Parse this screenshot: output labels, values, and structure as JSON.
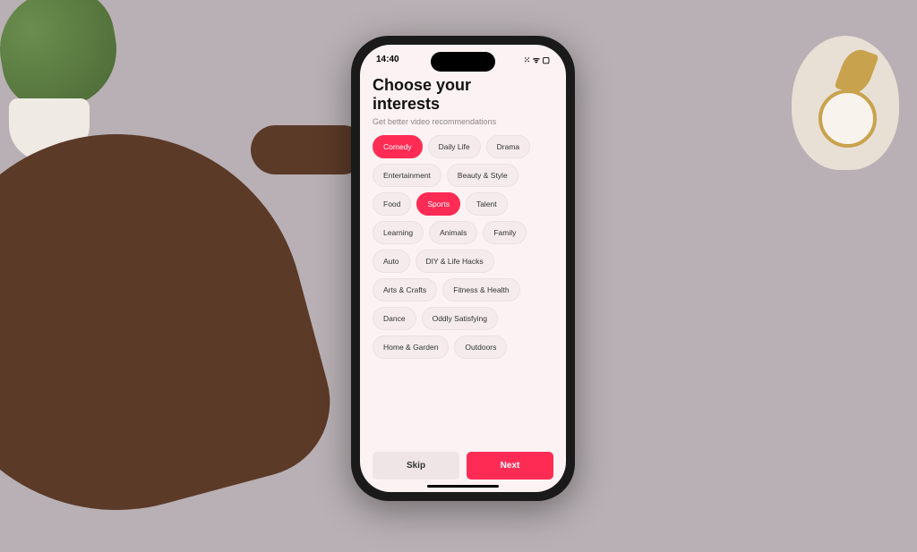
{
  "status": {
    "time": "14:40",
    "icons": "⁙ ᯤ ▢"
  },
  "header": {
    "title_line1": "Choose your",
    "title_line2": "interests",
    "subtitle": "Get better video recommendations"
  },
  "chips": [
    {
      "label": "Comedy",
      "selected": true
    },
    {
      "label": "Daily Life",
      "selected": false
    },
    {
      "label": "Drama",
      "selected": false
    },
    {
      "label": "Entertainment",
      "selected": false
    },
    {
      "label": "Beauty & Style",
      "selected": false
    },
    {
      "label": "Food",
      "selected": false
    },
    {
      "label": "Sports",
      "selected": true
    },
    {
      "label": "Talent",
      "selected": false
    },
    {
      "label": "Learning",
      "selected": false
    },
    {
      "label": "Animals",
      "selected": false
    },
    {
      "label": "Family",
      "selected": false
    },
    {
      "label": "Auto",
      "selected": false
    },
    {
      "label": "DIY & Life Hacks",
      "selected": false
    },
    {
      "label": "Arts & Crafts",
      "selected": false
    },
    {
      "label": "Fitness & Health",
      "selected": false
    },
    {
      "label": "Dance",
      "selected": false
    },
    {
      "label": "Oddly Satisfying",
      "selected": false
    },
    {
      "label": "Home & Garden",
      "selected": false
    },
    {
      "label": "Outdoors",
      "selected": false
    }
  ],
  "buttons": {
    "skip": "Skip",
    "next": "Next"
  },
  "colors": {
    "accent": "#fe2c55",
    "background": "#fcf2f3"
  }
}
